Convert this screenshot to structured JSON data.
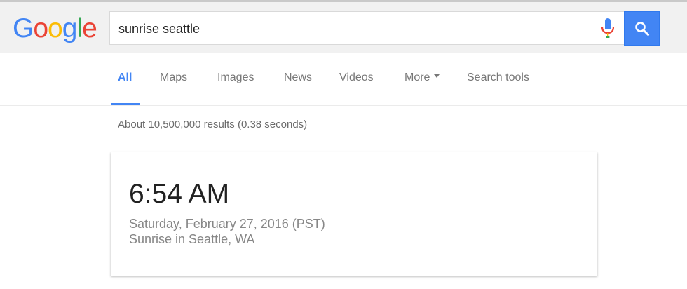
{
  "header": {
    "logo_letters": [
      {
        "char": "G",
        "color": "#4285f4"
      },
      {
        "char": "o",
        "color": "#ea4335"
      },
      {
        "char": "o",
        "color": "#fbbc05"
      },
      {
        "char": "g",
        "color": "#4285f4"
      },
      {
        "char": "l",
        "color": "#34a853"
      },
      {
        "char": "e",
        "color": "#ea4335"
      }
    ],
    "search_value": "sunrise seattle",
    "mic_icon": "microphone-icon",
    "search_icon": "magnifier-icon",
    "search_button_color": "#4285f4"
  },
  "tabs": [
    {
      "label": "All",
      "active": true
    },
    {
      "label": "Maps",
      "active": false
    },
    {
      "label": "Images",
      "active": false
    },
    {
      "label": "News",
      "active": false
    },
    {
      "label": "Videos",
      "active": false
    },
    {
      "label": "More",
      "active": false,
      "dropdown": true
    },
    {
      "label": "Search tools",
      "active": false
    }
  ],
  "results": {
    "stats": "About 10,500,000 results (0.38 seconds)"
  },
  "answer_card": {
    "time": "6:54 AM",
    "date": "Saturday, February 27, 2016 (PST)",
    "place": "Sunrise in Seattle, WA"
  }
}
